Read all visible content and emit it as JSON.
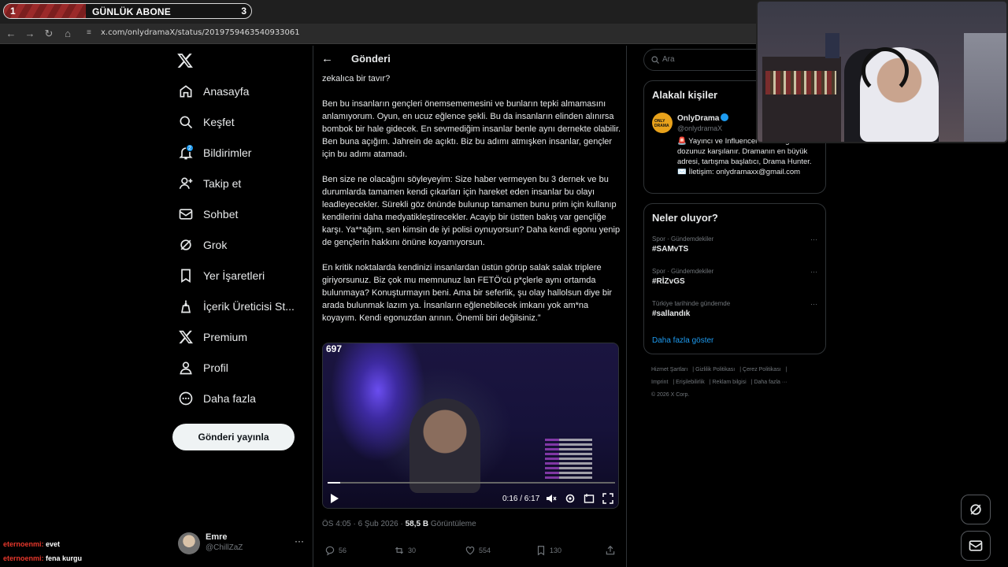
{
  "stream_goal": {
    "left_count": "1",
    "title": "GÜNLÜK ABONE",
    "right_count": "3",
    "progress": 0.33
  },
  "browser": {
    "url": "x.com/onlydramaX/status/2019759463540933061"
  },
  "nav": {
    "items": [
      {
        "label": "Anasayfa",
        "icon": "home-icon"
      },
      {
        "label": "Keşfet",
        "icon": "search-icon"
      },
      {
        "label": "Bildirimler",
        "icon": "bell-icon",
        "badge": "2"
      },
      {
        "label": "Takip et",
        "icon": "add-user-icon"
      },
      {
        "label": "Sohbet",
        "icon": "mail-icon"
      },
      {
        "label": "Grok",
        "icon": "grok-icon"
      },
      {
        "label": "Yer İşaretleri",
        "icon": "bookmark-icon"
      },
      {
        "label": "İçerik Üreticisi St...",
        "icon": "creator-icon"
      },
      {
        "label": "Premium",
        "icon": "x-logo-icon"
      },
      {
        "label": "Profil",
        "icon": "profile-icon"
      },
      {
        "label": "Daha fazla",
        "icon": "more-circle-icon"
      }
    ],
    "post_button": "Gönderi yayınla",
    "account": {
      "name": "Emre",
      "handle": "@ChillZaZ",
      "more": "···"
    }
  },
  "main": {
    "title": "Gönderi",
    "paragraphs": [
      "zekalıca bir tavır?",
      "Ben bu insanların gençleri önemsememesini ve bunların tepki almamasını anlamıyorum. Oyun, en ucuz eğlence şekli. Bu da insanların elinden alınırsa bombok bir hale gidecek. En sevmediğim insanlar benle aynı dernekte olabilir. Ben buna açığım. Jahrein de açıktı. Biz bu adımı atmışken insanlar, gençler için bu adımı atamadı.",
      "Ben size ne olacağını söyleyeyim: Size haber vermeyen bu 3 dernek ve bu durumlarda tamamen kendi çıkarları için hareket eden insanlar bu olayı leadleyecekler. Sürekli göz önünde bulunup tamamen bunu prim için kullanıp kendilerini daha medyatikleştirecekler. Acayip bir üstten bakış var gençliğe karşı. Ya**ağım, sen kimsin de iyi polisi oynuyorsun? Daha kendi egonu yenip de gençlerin hakkını önüne koyamıyorsun.",
      "En kritik noktalarda kendinizi insanlardan üstün görüp salak salak triplere giriyorsunuz. Biz çok mu memnunuz lan FETÖ'cü p*çlerle aynı ortamda bulunmaya? Konuşturmayın beni. Ama bir seferlik, şu olay hallolsun diye bir arada bulunmak lazım ya. İnsanların eğlenebilecek imkanı yok am*na koyayım. Kendi egonuzdan arının. Önemli biri değilsiniz.”"
    ],
    "video": {
      "overlay_count": "697",
      "time": "0:16 / 6:17",
      "progress": 0.043
    },
    "meta": {
      "time": "ÖS 4:05 · 6 Şub 2026 · ",
      "views": "58,5 B",
      "views_label": " Görüntüleme"
    },
    "actions": {
      "replies": "56",
      "reposts": "30",
      "likes": "554",
      "bookmarks": "130"
    }
  },
  "sidebar": {
    "search_placeholder": "Ara",
    "related": {
      "title": "Alakalı kişiler",
      "name": "OnlyDrama",
      "handle": "@onlydramaX",
      "avatar_text": "ONLY DRAMA",
      "bio": "🚨 Yayıncı ve Influencer d... Kavga dozunuz karşılanır. Dramanın en büyük adresi, tartışma başlatıcı, Drama Hunter. ✉️ İletişim: onlydramaxx@gmail.com"
    },
    "trends": {
      "title": "Neler oluyor?",
      "items": [
        {
          "category": "Spor · Gündemdekiler",
          "name": "#SAMvTS"
        },
        {
          "category": "Spor · Gündemdekiler",
          "name": "#RİZvGS"
        },
        {
          "category": "Türkiye tarihinde gündemde",
          "name": "#sallandık"
        }
      ],
      "more_glyph": "···",
      "show_more": "Daha fazla göster"
    },
    "footer": {
      "links": [
        "Hizmet Şartları",
        "Gizlilik Politikası",
        "Çerez Politikası",
        "Imprint",
        "Erişilebilirlik",
        "Reklam bilgisi",
        "Daha fazla ···"
      ],
      "copyright": "© 2026 X Corp."
    }
  },
  "chat": [
    {
      "user": "eternoenmi:",
      "text": " evet"
    },
    {
      "user": "eternoenmi:",
      "text": " fena kurgu"
    }
  ],
  "colors": {
    "accent": "#1d9bf0",
    "border": "#2f3336",
    "muted": "#71767b",
    "goal_fill": "#9b2a2a"
  }
}
